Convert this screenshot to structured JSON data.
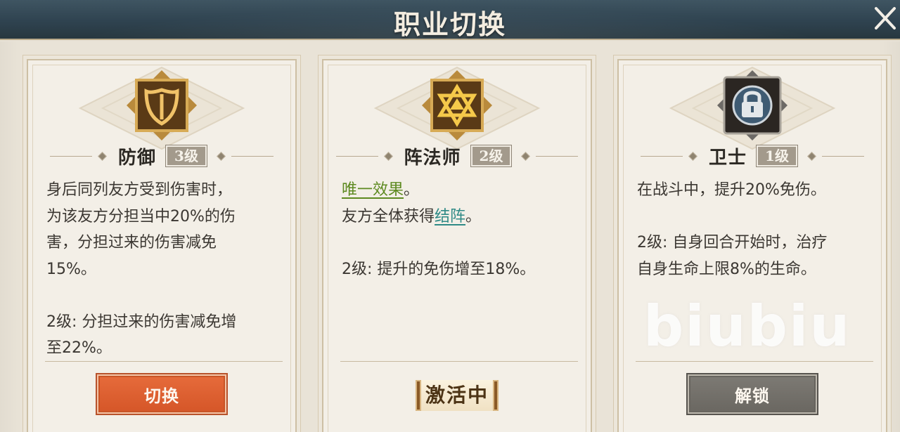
{
  "header": {
    "title": "职业切换"
  },
  "cards": [
    {
      "name": "防御",
      "level": "3级",
      "icon": "shield-icon",
      "desc_lines": [
        "身后同列友方受到伤害时，",
        "为该友方分担当中20%的伤",
        "害，分担过来的伤害减免",
        "15%。"
      ],
      "upgrade_lines": [
        "2级: 分担过来的伤害减免增",
        "至22%。"
      ],
      "button_label": "切换",
      "button_color": "#e0622f"
    },
    {
      "name": "阵法师",
      "level": "2级",
      "icon": "star-triangle-icon",
      "unique_effect": "唯一效果",
      "unique_suffix": "。",
      "line2_prefix": "友方全体获得",
      "line2_keyword": "结阵",
      "line2_suffix": "。",
      "upgrade_lines": [
        "2级: 提升的免伤增至18%。"
      ],
      "status_label": "激活中"
    },
    {
      "name": "卫士",
      "level": "1级",
      "icon": "lock-icon",
      "desc_lines": [
        "在战斗中，提升20%免伤。"
      ],
      "upgrade_lines": [
        "2级: 自身回合开始时，治疗",
        "自身生命上限8%的生命。"
      ],
      "button_label": "解锁",
      "button_color": "#75726c"
    }
  ],
  "watermark": "biubiu"
}
